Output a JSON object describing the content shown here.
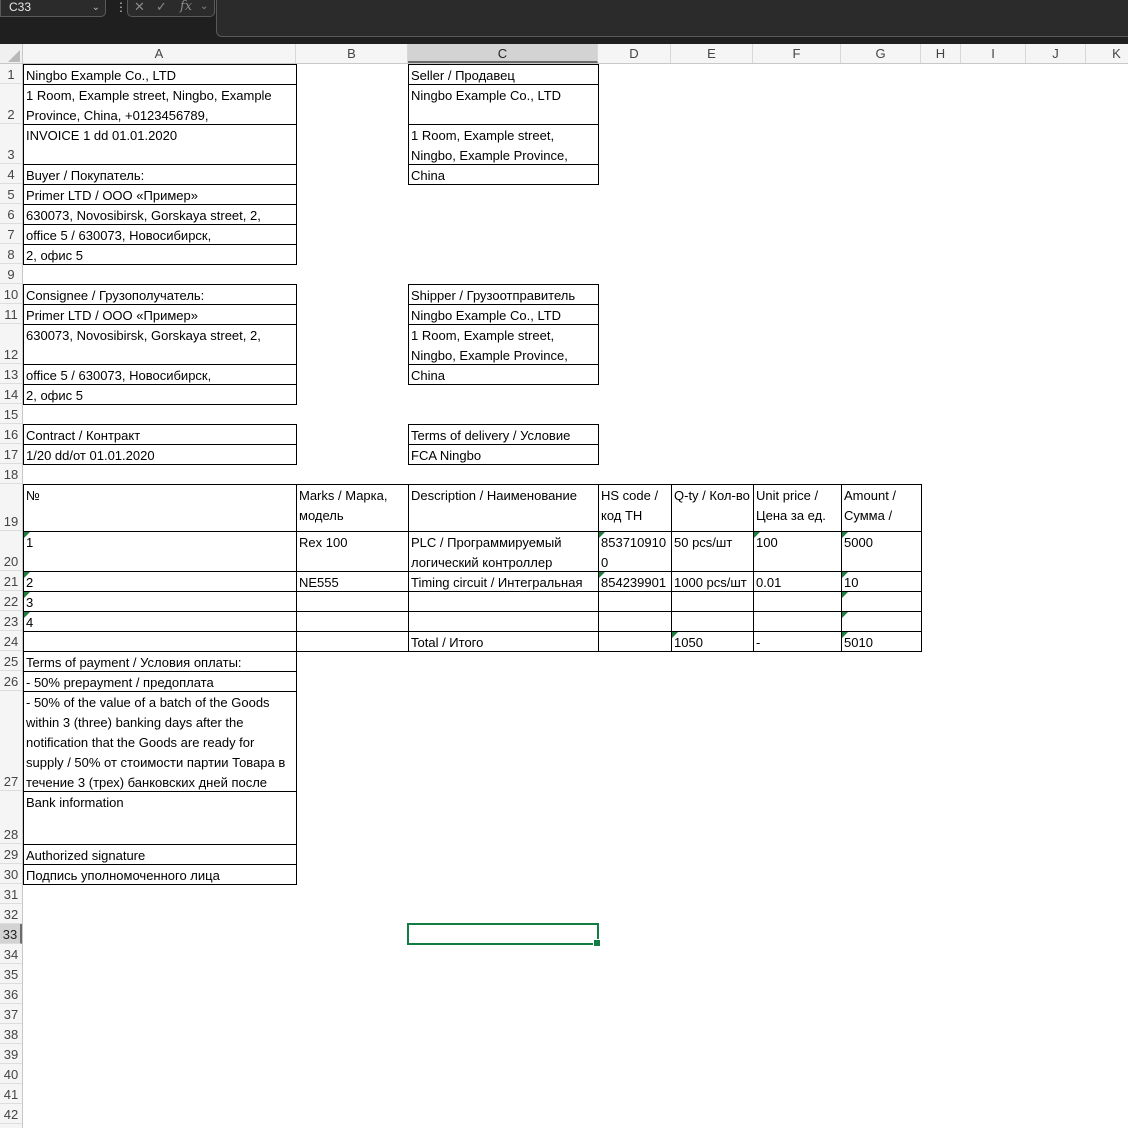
{
  "toolbar": {
    "name_box": "C33",
    "kebab": "⋮",
    "cancel_glyph": "✕",
    "enter_glyph": "✓",
    "fx_glyph": "fx",
    "formula_text": ""
  },
  "columns": [
    "A",
    "B",
    "C",
    "D",
    "E",
    "F",
    "G",
    "H",
    "I",
    "J",
    "K"
  ],
  "selected_column": "C",
  "selected_row": 33,
  "rows": [
    1,
    2,
    3,
    4,
    5,
    6,
    7,
    8,
    9,
    10,
    11,
    12,
    13,
    14,
    15,
    16,
    17,
    18,
    19,
    20,
    21,
    22,
    23,
    24,
    25,
    26,
    27,
    28,
    29,
    30,
    31,
    32,
    33,
    34,
    35,
    36,
    37,
    38,
    39,
    40,
    41,
    42
  ],
  "cells": {
    "A1": "Ningbo Example Co., LTD",
    "A2": "1 Room, Example street, Ningbo, Example Province, China, +0123456789,",
    "A3": "INVOICE 1 dd 01.01.2020",
    "A4": "Buyer / Покупатель:",
    "A5": "Primer LTD / ООО «Пример»",
    "A6": "630073, Novosibirsk, Gorskaya street, 2,",
    "A7": "office 5 / 630073, Новосибирск,",
    "A8": "2, офис 5",
    "A10": "Consignee / Грузополучатель:",
    "A11": "Primer LTD / ООО «Пример»",
    "A12": "630073, Novosibirsk, Gorskaya street, 2,",
    "A13": "office 5 / 630073, Новосибирск,",
    "A14": "2, офис 5",
    "A16": "Contract / Контракт",
    "A17": "1/20 dd/от 01.01.2020",
    "C1": "Seller / Продавец",
    "C2": "Ningbo Example Co., LTD",
    "C3": "1 Room, Example street, Ningbo, Example Province,",
    "C4": "China",
    "C10": "Shipper / Грузоотправитель",
    "C11": "Ningbo Example Co., LTD",
    "C12": "1 Room, Example street, Ningbo, Example Province,",
    "C13": "China",
    "C16": "Terms of delivery / Условие",
    "C17": "FCA Ningbo",
    "A19": "№",
    "B19": "Marks / Марка, модель",
    "C19": "Description / Наименование",
    "D19": "HS code / код ТН",
    "E19": "Q-ty / Кол-во",
    "F19": "Unit price / Цена за ед.",
    "G19": "Amount / Сумма /",
    "A20": "1",
    "B20": "Rex 100",
    "C20": "PLC / Программируемый логический контроллер",
    "D20": "8537109100",
    "E20": "50 pcs/шт",
    "F20": "100",
    "G20": "5000",
    "A21": "2",
    "B21": "NE555",
    "C21": "Timing circuit / Интегральная",
    "D21": "854239901",
    "E21": "1000 pcs/шт",
    "F21": "0.01",
    "G21": "10",
    "A22": "3",
    "A23": "4",
    "C24": "Total / Итого",
    "E24": "1050",
    "F24": "-",
    "G24": "5010",
    "A25": "Terms of payment / Условия оплаты:",
    "A26": "- 50% prepayment / предоплата",
    "A27": "- 50% of the value of a batch of the Goods within 3 (three) banking days after the notification that the Goods are ready for supply / 50% от стоимости партии Товара в течение 3 (трех) банковских дней после",
    "A28": "Bank information",
    "A29": "Authorized signature",
    "A30": "Подпись уполномоченного лица"
  }
}
